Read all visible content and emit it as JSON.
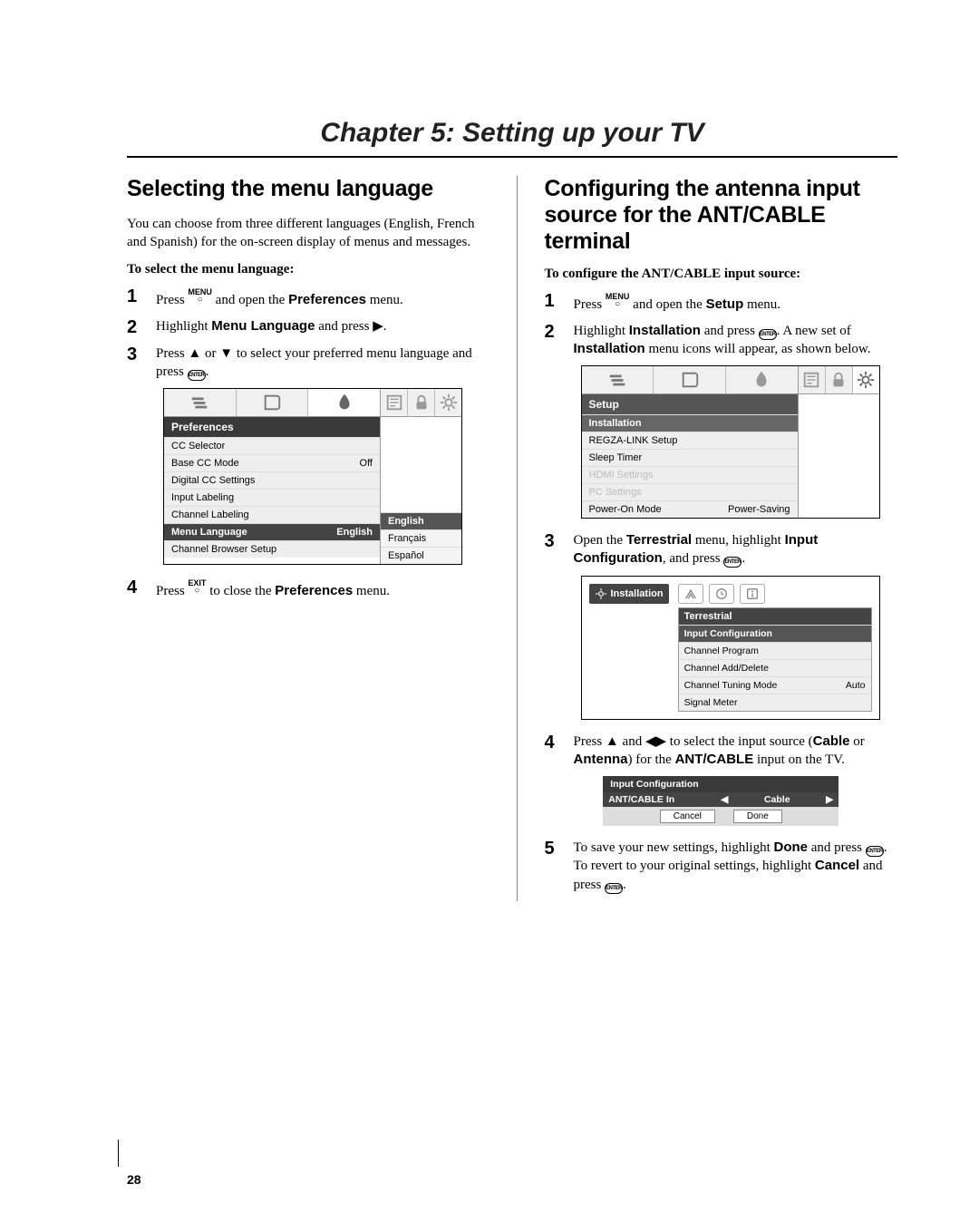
{
  "page_number": "28",
  "chapter_title": "Chapter 5: Setting up your TV",
  "left": {
    "title": "Selecting the menu language",
    "intro": "You can choose from three different languages (English, French and Spanish) for the on-screen display of menus and messages.",
    "subhead": "To select the menu language:",
    "steps": {
      "s1_a": "Press ",
      "s1_b": " and open the ",
      "s1_c": " menu.",
      "s1_bold": "Preferences",
      "s2_a": "Highlight ",
      "s2_bold": "Menu Language",
      "s2_b": " and press ",
      "s3_a": "Press ",
      "s3_b": " or ",
      "s3_c": " to select your preferred menu language and press ",
      "s4_a": "Press ",
      "s4_b": " to close the ",
      "s4_bold": "Preferences",
      "s4_c": " menu."
    },
    "shot": {
      "header": "Preferences",
      "rows": [
        {
          "label": "CC Selector",
          "val": ""
        },
        {
          "label": "Base CC Mode",
          "val": "Off"
        },
        {
          "label": "Digital CC Settings",
          "val": ""
        },
        {
          "label": "Input Labeling",
          "val": ""
        },
        {
          "label": "Channel Labeling",
          "val": ""
        }
      ],
      "sel": {
        "label": "Menu Language",
        "val": "English"
      },
      "after": {
        "label": "Channel Browser Setup",
        "val": ""
      },
      "options": [
        "English",
        "Français",
        "Español"
      ]
    }
  },
  "right": {
    "title": "Configuring the antenna input source for the ANT/CABLE terminal",
    "subhead": "To configure the ANT/CABLE input source:",
    "steps": {
      "s1_a": "Press ",
      "s1_b": " and open the ",
      "s1_bold": "Setup",
      "s1_c": " menu.",
      "s2_a": "Highlight ",
      "s2_bold1": "Installation",
      "s2_b": " and press ",
      "s2_c": ". A new set of ",
      "s2_bold2": "Installation",
      "s2_d": " menu icons will appear, as shown below.",
      "s3_a": "Open the ",
      "s3_bold1": "Terrestrial",
      "s3_b": " menu, highlight ",
      "s3_bold2": "Input Configuration",
      "s3_c": ", and press ",
      "s4_a": "Press ",
      "s4_b": " and ",
      "s4_c": " to select the input source (",
      "s4_bold1": "Cable",
      "s4_d": " or ",
      "s4_bold2": "Antenna",
      "s4_e": ") for the ",
      "s4_bold3": "ANT/CABLE",
      "s4_f": " input on the TV.",
      "s5_a": "To save your new settings, highlight ",
      "s5_bold1": "Done",
      "s5_b": " and press ",
      "s5_c": ". To revert to your original settings, highlight ",
      "s5_bold2": "Cancel",
      "s5_d": " and press "
    },
    "shot_setup": {
      "header1": "Setup",
      "header2": "Installation",
      "rows": [
        {
          "label": "REGZA-LINK Setup",
          "val": "",
          "disabled": false
        },
        {
          "label": "Sleep Timer",
          "val": "",
          "disabled": false
        },
        {
          "label": "HDMI Settings",
          "val": "",
          "disabled": true
        },
        {
          "label": "PC Settings",
          "val": "",
          "disabled": true
        },
        {
          "label": "Power-On Mode",
          "val": "Power-Saving",
          "disabled": false
        }
      ]
    },
    "shot_terr": {
      "badge": "Installation",
      "header": "Terrestrial",
      "sel": "Input Configuration",
      "rows": [
        {
          "label": "Channel Program",
          "val": ""
        },
        {
          "label": "Channel Add/Delete",
          "val": ""
        },
        {
          "label": "Channel Tuning Mode",
          "val": "Auto"
        },
        {
          "label": "Signal Meter",
          "val": ""
        }
      ]
    },
    "shot_input": {
      "header": "Input Configuration",
      "row_label": "ANT/CABLE In",
      "row_value": "Cable",
      "btn_cancel": "Cancel",
      "btn_done": "Done"
    }
  },
  "glyphs": {
    "menu": "MENU",
    "exit": "EXIT",
    "enter": "ENTER",
    "up": "▲",
    "down": "▼",
    "left": "◀",
    "right": "▶"
  }
}
